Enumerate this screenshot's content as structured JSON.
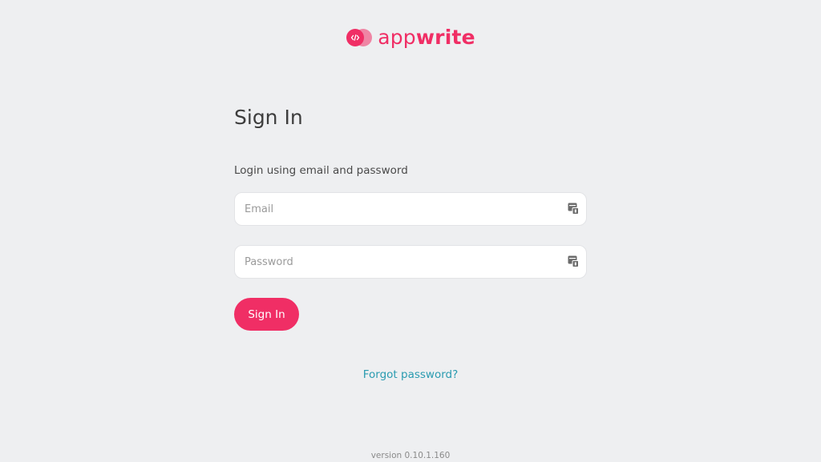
{
  "logo": {
    "text_light": "app",
    "text_bold": "write",
    "icon": "appwrite-logo-icon"
  },
  "signin": {
    "title": "Sign In",
    "subtitle": "Login using email and password",
    "email_placeholder": "Email",
    "email_value": "",
    "password_placeholder": "Password",
    "password_value": "",
    "field_icon": "password-manager-icon",
    "submit_label": "Sign In",
    "forgot_label": "Forgot password?"
  },
  "footer": {
    "version": "version 0.10.1.160"
  },
  "colors": {
    "brand": "#f02e65",
    "link": "#2a9bb0",
    "background": "#eeeff1"
  }
}
